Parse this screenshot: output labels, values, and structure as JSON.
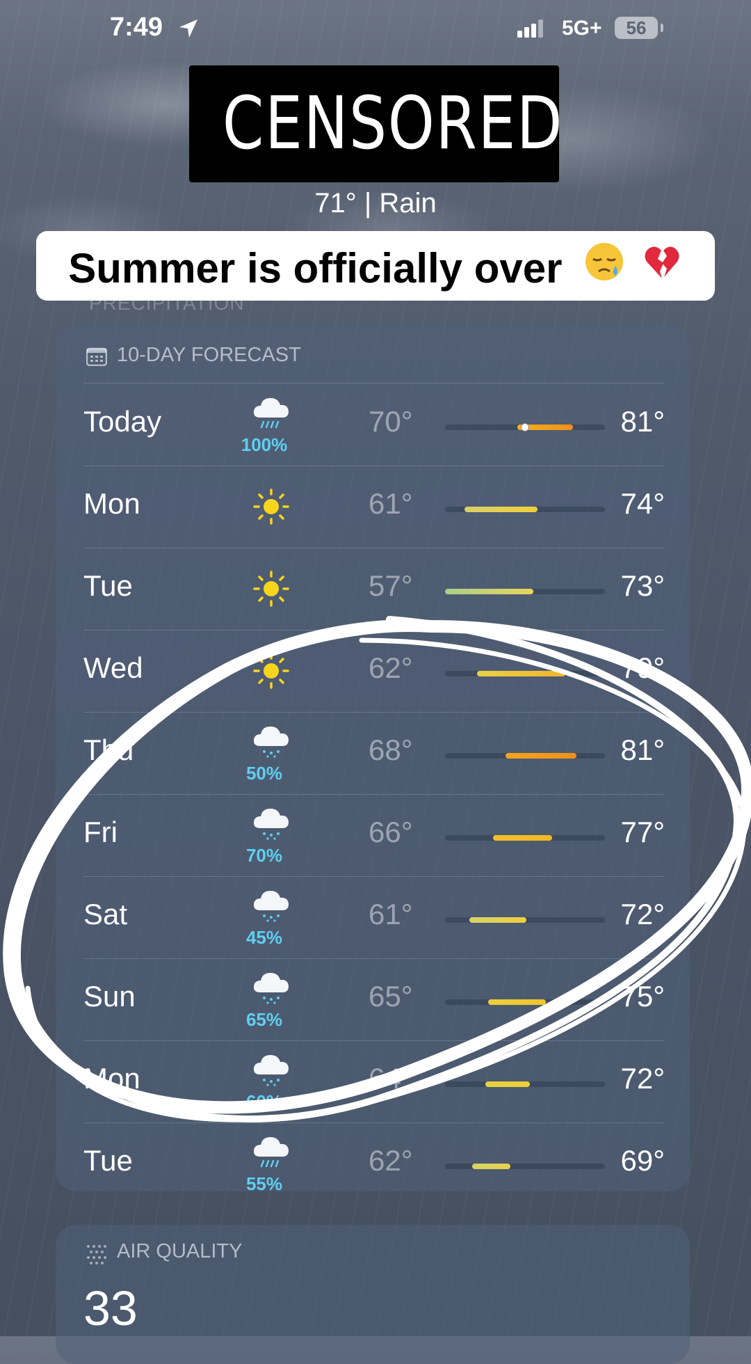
{
  "status_bar": {
    "time": "7:49",
    "network": "5G+",
    "battery": "56"
  },
  "header": {
    "censor_label": "CENSORED",
    "condition": "71°  |  Rain"
  },
  "caption": {
    "text": "Summer is officially over"
  },
  "ghost_label": "PRECIPITATION",
  "forecast": {
    "title": "10-DAY FORECAST",
    "days": [
      {
        "day": "Today",
        "icon": "heavy-rain-icon",
        "precip": "100%",
        "low": "70°",
        "high": "81°",
        "range_start": 0.45,
        "range_end": 0.8,
        "current": 0.5,
        "color_from": "#f6b21a",
        "color_to": "#f09018"
      },
      {
        "day": "Mon",
        "icon": "sun-icon",
        "precip": "",
        "low": "61°",
        "high": "74°",
        "range_start": 0.12,
        "range_end": 0.58,
        "color_from": "#d9d06a",
        "color_to": "#f2cf3a"
      },
      {
        "day": "Tue",
        "icon": "sun-icon",
        "precip": "",
        "low": "57°",
        "high": "73°",
        "range_start": 0.0,
        "range_end": 0.55,
        "color_from": "#a9cf8c",
        "color_to": "#e9d55a"
      },
      {
        "day": "Wed",
        "icon": "sun-icon",
        "precip": "",
        "low": "62°",
        "high": "79°",
        "range_start": 0.2,
        "range_end": 0.75,
        "color_from": "#e8d24a",
        "color_to": "#f3b42a"
      },
      {
        "day": "Thu",
        "icon": "rain-icon",
        "precip": "50%",
        "low": "68°",
        "high": "81°",
        "range_start": 0.38,
        "range_end": 0.82,
        "color_from": "#f3a51e",
        "color_to": "#f09018"
      },
      {
        "day": "Fri",
        "icon": "rain-icon",
        "precip": "70%",
        "low": "66°",
        "high": "77°",
        "range_start": 0.3,
        "range_end": 0.67,
        "color_from": "#f1c12a",
        "color_to": "#f2b81f"
      },
      {
        "day": "Sat",
        "icon": "rain-icon",
        "precip": "45%",
        "low": "61°",
        "high": "72°",
        "range_start": 0.15,
        "range_end": 0.51,
        "color_from": "#d6d26a",
        "color_to": "#eed03c"
      },
      {
        "day": "Sun",
        "icon": "rain-icon",
        "precip": "65%",
        "low": "65°",
        "high": "75°",
        "range_start": 0.27,
        "range_end": 0.63,
        "color_from": "#eccf3a",
        "color_to": "#f1c52b"
      },
      {
        "day": "Mon",
        "icon": "rain-icon",
        "precip": "60%",
        "low": "64°",
        "high": "72°",
        "range_start": 0.25,
        "range_end": 0.53,
        "color_from": "#e6d242",
        "color_to": "#efcf35"
      },
      {
        "day": "Tue",
        "icon": "heavy-rain-icon",
        "precip": "55%",
        "low": "62°",
        "high": "69°",
        "range_start": 0.17,
        "range_end": 0.41,
        "color_from": "#d6d463",
        "color_to": "#e6d24a"
      }
    ]
  },
  "air_quality": {
    "title": "AIR QUALITY",
    "value": "33"
  },
  "colors": {
    "precip_blue": "#5ecff2",
    "card_bg": "#50607a",
    "sun_yellow": "#f7d51d"
  }
}
